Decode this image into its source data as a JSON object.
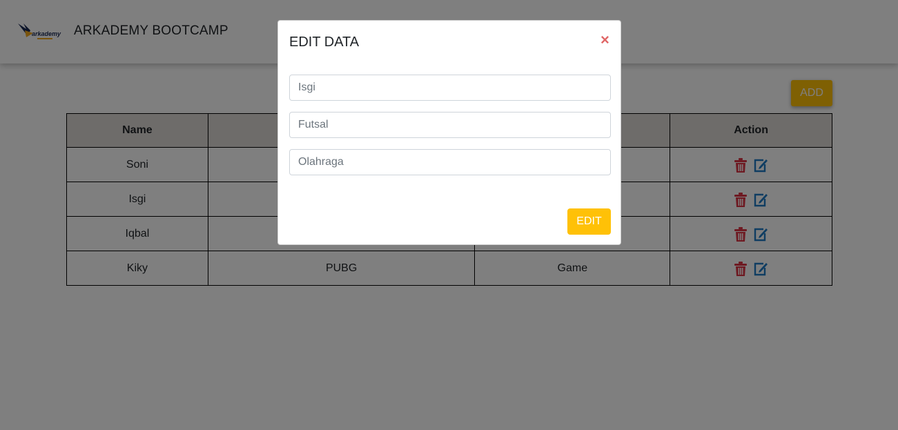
{
  "header": {
    "brand": "ARKADEMY BOOTCAMP"
  },
  "toolbar": {
    "add_label": "ADD"
  },
  "table": {
    "headers": [
      "Name",
      "",
      "",
      "Action"
    ],
    "rows": [
      {
        "name": "Soni",
        "col2": "",
        "col3": ""
      },
      {
        "name": "Isgi",
        "col2": "",
        "col3": ""
      },
      {
        "name": "Iqbal",
        "col2": "",
        "col3": ""
      },
      {
        "name": "Kiky",
        "col2": "PUBG",
        "col3": "Game"
      }
    ]
  },
  "modal": {
    "title": "EDIT DATA",
    "close": "×",
    "fields": [
      {
        "placeholder": "Isgi"
      },
      {
        "placeholder": "Futsal"
      },
      {
        "placeholder": "Olahraga"
      }
    ],
    "submit_label": "EDIT"
  },
  "colors": {
    "accent": "#ffc107",
    "danger": "#dc3545",
    "primary": "#1f7ac4",
    "close": "#e06666"
  },
  "icons": {
    "delete": "trash-icon",
    "edit": "edit-icon"
  }
}
